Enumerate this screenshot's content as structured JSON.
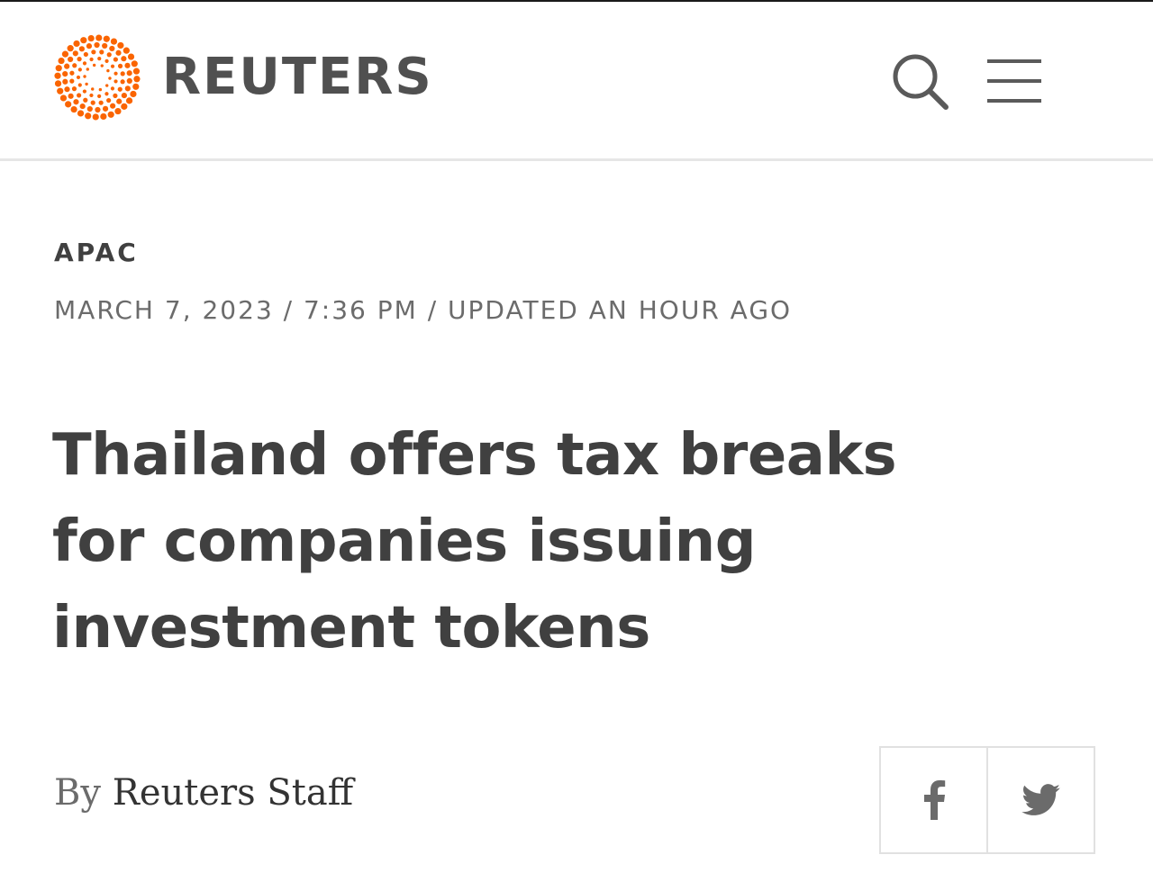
{
  "brand": {
    "name": "REUTERS",
    "logo_color": "#fa6400"
  },
  "header": {
    "search_icon": "search-icon",
    "menu_icon": "hamburger-menu-icon"
  },
  "article": {
    "section": "APAC",
    "dateline": "MARCH 7, 2023 / 7:36 PM / UPDATED AN HOUR AGO",
    "headline": "Thailand offers tax breaks for companies issuing investment tokens",
    "byline_prefix": "By",
    "author": "Reuters Staff"
  },
  "share": {
    "facebook_icon": "facebook-icon",
    "twitter_icon": "twitter-icon"
  }
}
